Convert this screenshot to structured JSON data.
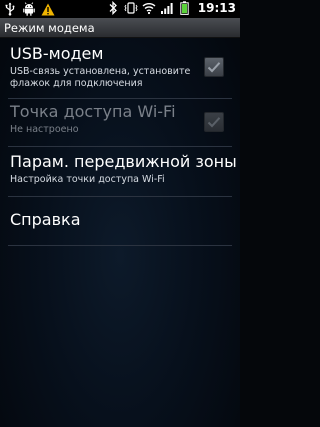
{
  "status_bar": {
    "time": "19:13",
    "icons": [
      "usb-icon",
      "android-debug-icon",
      "warning-icon",
      "bluetooth-icon",
      "vibrate-icon",
      "wifi-icon",
      "signal-icon",
      "battery-icon"
    ]
  },
  "title_bar": {
    "title": "Режим модема"
  },
  "items": [
    {
      "title": "USB-модем",
      "summary": "USB-связь установлена, установите флажок для подключения",
      "checkbox": true,
      "checked": true,
      "enabled": true
    },
    {
      "title": "Точка доступа Wi-Fi",
      "summary": "Не настроено",
      "checkbox": true,
      "checked": true,
      "enabled": false
    },
    {
      "title": "Парам. передвижной зоны",
      "summary": "Настройка точки доступа Wi-Fi",
      "checkbox": false,
      "enabled": true
    },
    {
      "title": "Справка",
      "checkbox": false,
      "enabled": true
    }
  ],
  "colors": {
    "background": "#07101c",
    "title_bar": "#3a3d42",
    "text": "#ffffff",
    "disabled_text": "#7a8089",
    "divider": "#2b3340"
  }
}
